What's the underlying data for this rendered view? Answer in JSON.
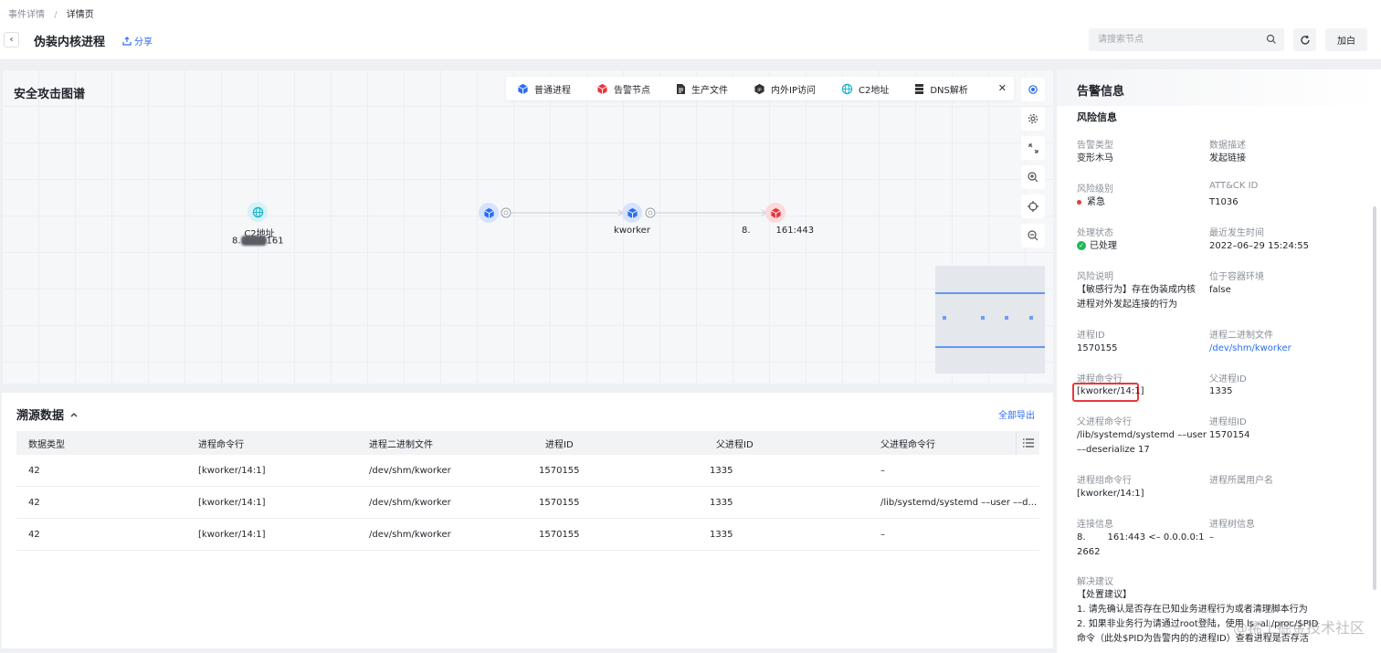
{
  "breadcrumb": {
    "parent": "事件详情",
    "separator": "/",
    "current": "详情页"
  },
  "header": {
    "title": "伪装内核进程",
    "share_label": "分享",
    "search_placeholder": "请搜索节点",
    "whitelist_label": "加白"
  },
  "graph": {
    "title": "安全攻击图谱",
    "legend": [
      {
        "label": "普通进程",
        "icon": "cube-icon",
        "color": "#2b6df2"
      },
      {
        "label": "告警节点",
        "icon": "cube-alert-icon",
        "color": "#e8383d"
      },
      {
        "label": "生产文件",
        "icon": "file-icon",
        "color": "#333333"
      },
      {
        "label": "内外IP访问",
        "icon": "ip-icon",
        "color": "#333333"
      },
      {
        "label": "C2地址",
        "icon": "globe-icon",
        "color": "#13b3c9"
      },
      {
        "label": "DNS解析",
        "icon": "server-icon",
        "color": "#333333"
      }
    ],
    "nodes": {
      "c2": {
        "title": "C2地址",
        "addr_prefix": "8.",
        "addr_suffix": "161"
      },
      "kworker": {
        "label": "kworker"
      },
      "ip": {
        "prefix": "8.",
        "suffix": "161:443"
      }
    }
  },
  "trace": {
    "title": "溯源数据",
    "export_label": "全部导出",
    "columns": [
      "数据类型",
      "进程命令行",
      "进程二进制文件",
      "进程ID",
      "父进程ID",
      "父进程命令行"
    ],
    "rows": [
      [
        "42",
        "[kworker/14:1]",
        "/dev/shm/kworker",
        "1570155",
        "1335",
        "–"
      ],
      [
        "42",
        "[kworker/14:1]",
        "/dev/shm/kworker",
        "1570155",
        "1335",
        "/lib/systemd/systemd ––user ––d..."
      ],
      [
        "42",
        "[kworker/14:1]",
        "/dev/shm/kworker",
        "1570155",
        "1335",
        "–"
      ]
    ]
  },
  "alert": {
    "title": "告警信息",
    "section": "风险信息",
    "fields": {
      "alert_type": {
        "label": "告警类型",
        "value": "变形木马"
      },
      "data_desc": {
        "label": "数据描述",
        "value": "发起链接"
      },
      "risk_level": {
        "label": "风险级别",
        "value": "紧急"
      },
      "attck_id": {
        "label": "ATT&CK ID",
        "value": "T1036"
      },
      "status": {
        "label": "处理状态",
        "value": "已处理"
      },
      "last_time": {
        "label": "最近发生时间",
        "value": "2022–06–29 15:24:55"
      },
      "risk_desc": {
        "label": "风险说明",
        "line1": "【敏感行为】存在伪装成内核",
        "line2": "进程对外发起连接的行为"
      },
      "container": {
        "label": "位于容器环境",
        "value": "false"
      },
      "pid": {
        "label": "进程ID",
        "value": "1570155"
      },
      "binary": {
        "label": "进程二进制文件",
        "value": "/dev/shm/kworker"
      },
      "cmdline": {
        "label": "进程命令行",
        "value": "[kworker/14:1]"
      },
      "ppid": {
        "label": "父进程ID",
        "value": "1335"
      },
      "parent_cmd": {
        "label": "父进程命令行",
        "line1": "/lib/systemd/systemd ––user",
        "line2": "––deserialize 17"
      },
      "pgid": {
        "label": "进程组ID",
        "value": "1570154"
      },
      "group_cmd": {
        "label": "进程组命令行",
        "value": "[kworker/14:1]"
      },
      "user": {
        "label": "进程所属用户名",
        "value": ""
      },
      "conn": {
        "label": "连接信息",
        "prefix": "8.",
        "line1": "161:443 <– 0.0.0.0:1",
        "line2": "2662"
      },
      "tree": {
        "label": "进程树信息",
        "value": "–"
      },
      "advice": {
        "label": "解决建议",
        "l1": "【处置建议】",
        "l2": "1. 请先确认是否存在已知业务进程行为或者清理脚本行为",
        "l3": "2. 如果非业务行为请通过root登陆，使用 ls -al /proc/$PID",
        "l4": "命令（此处$PID为告警内的的进程ID）查看进程是否存活"
      }
    }
  },
  "watermark": "@稀土掘金技术社区"
}
